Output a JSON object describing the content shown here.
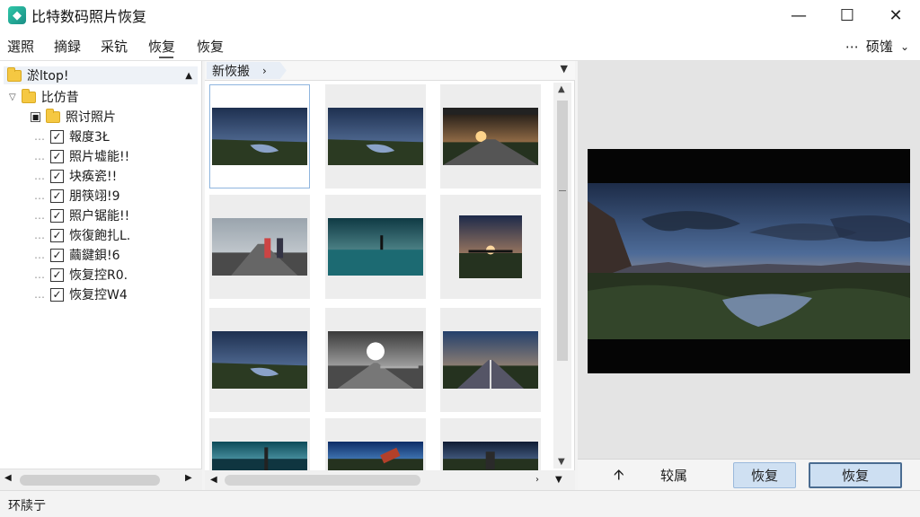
{
  "window": {
    "title": "比特数码照片恢复",
    "app_icon": "app-logo-icon",
    "controls": [
      "minimize-icon",
      "maximize-icon",
      "close-icon"
    ]
  },
  "menu": {
    "items": [
      "選照",
      "摘録",
      "采钪",
      "恢复",
      "恢复"
    ],
    "right_label": "硕馐",
    "right_icon": "more-dots-icon"
  },
  "tree": {
    "header": "淤ltop!",
    "root": "比仿昔",
    "folder": "照讨照片",
    "items": [
      "報度3Ł",
      "照片墟能!!",
      "块痪瓷!!",
      "朋筷翊!9",
      "照户锯能!!",
      "恢復飽扎L.",
      "繭鍵鋇!6",
      "恢复控R0.",
      "恢复控W4"
    ]
  },
  "gallery": {
    "breadcrumb": "新恢搬",
    "thumbnails": [
      {
        "scene": "lake-dusk",
        "selected": true
      },
      {
        "scene": "lake-dusk",
        "selected": false
      },
      {
        "scene": "station-sunset",
        "selected": false
      },
      {
        "scene": "road-people",
        "selected": false
      },
      {
        "scene": "teal-reflection",
        "selected": false
      },
      {
        "scene": "pier-square",
        "selected": false
      },
      {
        "scene": "lake-dusk",
        "selected": false
      },
      {
        "scene": "road-sunburst",
        "selected": false
      },
      {
        "scene": "rail-dusk",
        "selected": false
      },
      {
        "scene": "teal-top",
        "selected": false
      },
      {
        "scene": "blue-debris",
        "selected": false
      },
      {
        "scene": "dark-figure",
        "selected": false
      }
    ]
  },
  "preview": {
    "up_icon": "arrow-up-icon",
    "sort_label": "较属",
    "button_a": "恢复",
    "button_b": "恢复"
  },
  "status": {
    "text": "环牍亍"
  },
  "colors": {
    "accent": "#4a6c91",
    "button_fill": "#cfe0f2",
    "folder": "#f5c842"
  }
}
